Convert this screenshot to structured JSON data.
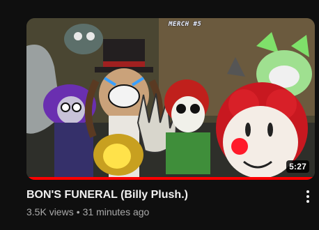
{
  "video": {
    "title": "BON'S FUNERAL (Billy Plush.)",
    "views": "3.5K views",
    "separator": "•",
    "age": "31 minutes ago",
    "duration": "5:27",
    "overlay_text": "MERCH #5",
    "watch_progress": 1.0
  },
  "icons": {
    "menu": "vertical-ellipsis-icon"
  },
  "colors": {
    "background": "#0f0f0f",
    "title": "#f1f1f1",
    "meta": "#aaaaaa",
    "progress": "#ff0000"
  }
}
